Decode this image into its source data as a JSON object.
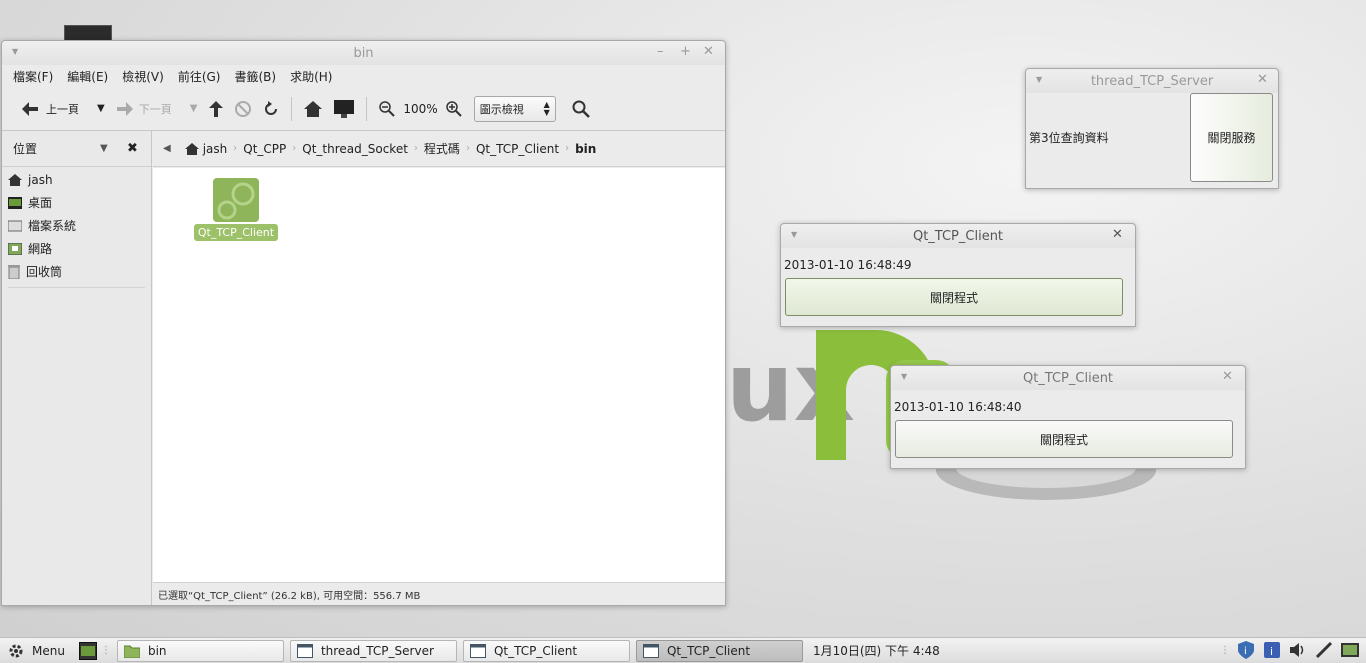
{
  "file_manager": {
    "title": "bin",
    "menus": [
      "檔案(F)",
      "編輯(E)",
      "檢視(V)",
      "前往(G)",
      "書籤(B)",
      "求助(H)"
    ],
    "toolbar": {
      "back_label": "上一頁",
      "forward_label": "下一頁",
      "zoom_level": "100%",
      "view_mode": "圖示檢視"
    },
    "sidebar": {
      "header": "位置",
      "items": [
        "jash",
        "桌面",
        "檔案系統",
        "網路",
        "回收筒"
      ]
    },
    "breadcrumb": [
      "jash",
      "Qt_CPP",
      "Qt_thread_Socket",
      "程式碼",
      "Qt_TCP_Client",
      "bin"
    ],
    "files": [
      {
        "name": "Qt_TCP_Client"
      }
    ],
    "status": "已選取“Qt_TCP_Client” (26.2 kB), 可用空間：556.7 MB"
  },
  "server_window": {
    "title": "thread_TCP_Server",
    "label": "第3位查詢資料",
    "button": "關閉服務"
  },
  "client_window_1": {
    "title": "Qt_TCP_Client",
    "timestamp": "2013-01-10 16:48:49",
    "button": "關閉程式"
  },
  "client_window_2": {
    "title": "Qt_TCP_Client",
    "timestamp": "2013-01-10 16:48:40",
    "button": "關閉程式"
  },
  "taskbar": {
    "menu_label": "Menu",
    "tasks": [
      "bin",
      "thread_TCP_Server",
      "Qt_TCP_Client",
      "Qt_TCP_Client"
    ],
    "clock": "1月10日(四) 下午 4:48"
  },
  "colors": {
    "accent_green": "#8fb55a",
    "selection_green": "#9dc168"
  }
}
